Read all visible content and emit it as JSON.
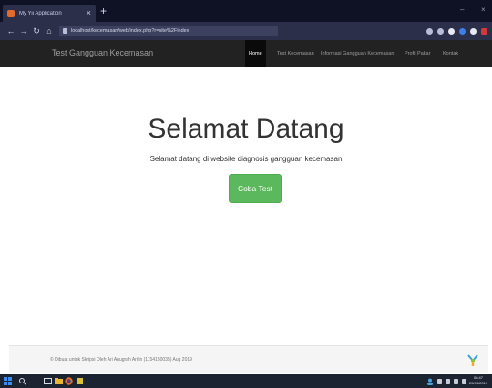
{
  "browser": {
    "tab_title": "My Yii Application",
    "new_tab": "+",
    "url": "localhost/kecemasan/web/index.php?r=site%2Findex",
    "minimize": "–",
    "close": "×",
    "nav_icons": [
      "back-icon",
      "forward-icon",
      "reload-icon",
      "home-icon"
    ],
    "toolbar_icons": [
      "menu-icon",
      "pocket-icon",
      "star-icon",
      "download-icon",
      "library-icon",
      "addon-icon"
    ]
  },
  "navbar": {
    "brand": "Test Gangguan Kecemasan",
    "items": [
      {
        "label": "Home",
        "active": true
      },
      {
        "label": "Test Kecemasan",
        "active": false
      },
      {
        "label": "Informasi Gangguan Kecemasan",
        "active": false
      },
      {
        "label": "Profil Pakar",
        "active": false
      },
      {
        "label": "Kontak",
        "active": false
      }
    ]
  },
  "main": {
    "heading": "Selamat Datang",
    "subtitle": "Selamat datang di website diagnosis gangguan kecemasan",
    "cta_label": "Coba Test"
  },
  "footer": {
    "text": "© Dibuat untuk Skripsi Oleh Ari Anugrah Arifin (1154150035) Aug 2019"
  },
  "taskbar": {
    "clock_time": "08:47",
    "clock_date": "20/08/2019",
    "colors": {
      "accent_green": "#5cb85c",
      "navbar": "#222222",
      "chrome": "#2b2f4a"
    }
  }
}
